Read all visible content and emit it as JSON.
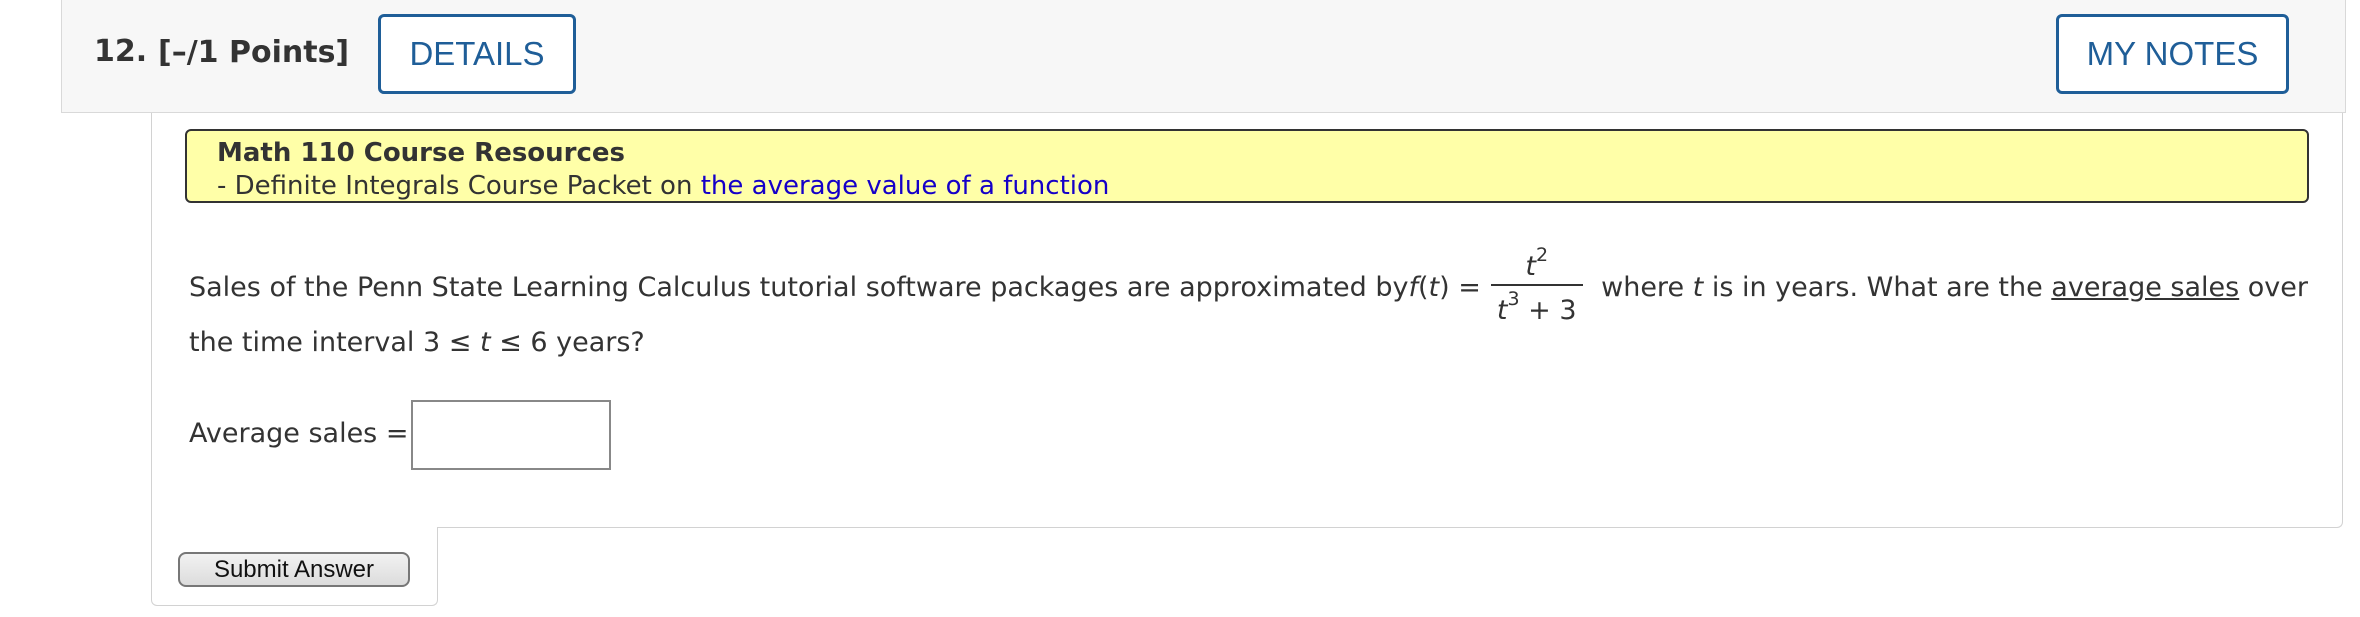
{
  "question": {
    "number": "12.",
    "points": "[–/1 Points]",
    "details_label": "DETAILS",
    "notes_label": "MY NOTES"
  },
  "resources": {
    "title": "Math 110 Course Resources",
    "line_prefix": "- Definite Integrals Course Packet on ",
    "link_text": "the average value of a function"
  },
  "statement": {
    "part1": "Sales of the Penn State Learning Calculus tutorial software packages are approximated by ",
    "func": "f",
    "func_open": "(",
    "func_var": "t",
    "func_close": ") =",
    "num_var": "t",
    "num_exp": "2",
    "den_var": "t",
    "den_exp": "3",
    "den_rest": " + 3",
    "part2": " where ",
    "var": "t",
    "part3": " is in years. What are the ",
    "underlined": "average sales",
    "part4": " over",
    "line2_a": "the time interval ",
    "interval_a": "3 ≤ ",
    "interval_var": "t",
    "interval_b": " ≤ 6",
    "line2_b": " years?"
  },
  "answer": {
    "label": "Average sales =",
    "value": ""
  },
  "submit_label": "Submit Answer"
}
